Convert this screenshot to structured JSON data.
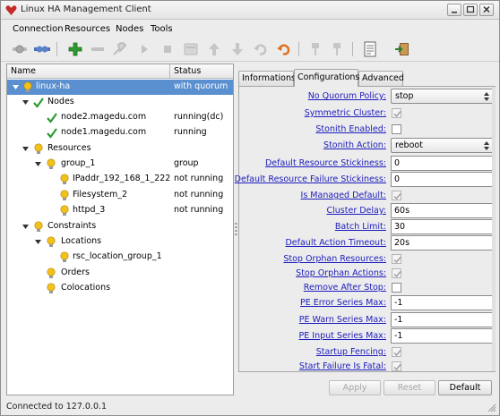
{
  "window": {
    "title": "Linux HA Management Client",
    "icon": "linux-ha-heart-icon"
  },
  "menubar": {
    "items": [
      "Connection",
      "Resources",
      "Nodes",
      "Tools"
    ]
  },
  "toolbar": {
    "icons": [
      "connect-icon",
      "disconnect-icon",
      "add-icon",
      "remove-icon",
      "cleanup-icon",
      "start-icon",
      "stop-icon",
      "default-view-icon",
      "move-up-icon",
      "move-down-icon",
      "undo-icon",
      "refresh-icon",
      "standby-node-icon",
      "active-node-icon",
      "log-icon",
      "exit-icon"
    ]
  },
  "tree": {
    "columns": {
      "name": "Name",
      "status": "Status"
    },
    "rows": [
      {
        "label": "linux-ha",
        "status": "with quorum",
        "icon": "bulb-icon",
        "expanded": true,
        "selected": true
      },
      {
        "label": "Nodes",
        "status": "",
        "icon": "check-icon",
        "expanded": true
      },
      {
        "label": "node2.magedu.com",
        "status": "running(dc)",
        "icon": "check-icon"
      },
      {
        "label": "node1.magedu.com",
        "status": "running",
        "icon": "check-icon"
      },
      {
        "label": "Resources",
        "status": "",
        "icon": "bulb-icon",
        "expanded": true
      },
      {
        "label": "group_1",
        "status": "group",
        "icon": "bulb-icon",
        "expanded": true
      },
      {
        "label": "IPaddr_192_168_1_222",
        "status": "not running",
        "icon": "bulb-icon"
      },
      {
        "label": "Filesystem_2",
        "status": "not running",
        "icon": "bulb-icon"
      },
      {
        "label": "httpd_3",
        "status": "not running",
        "icon": "bulb-icon"
      },
      {
        "label": "Constraints",
        "status": "",
        "icon": "bulb-icon",
        "expanded": true
      },
      {
        "label": "Locations",
        "status": "",
        "icon": "bulb-icon",
        "expanded": true
      },
      {
        "label": "rsc_location_group_1",
        "status": "",
        "icon": "bulb-icon"
      },
      {
        "label": "Orders",
        "status": "",
        "icon": "bulb-icon"
      },
      {
        "label": "Colocations",
        "status": "",
        "icon": "bulb-icon"
      }
    ]
  },
  "tabs": {
    "items": [
      "Informations",
      "Configurations",
      "Advanced"
    ],
    "active": "Configurations"
  },
  "config": {
    "fields": [
      {
        "label": "No Quorum Policy:",
        "type": "select",
        "value": "stop"
      },
      {
        "label": "Symmetric Cluster:",
        "type": "checkbox",
        "checked": true
      },
      {
        "label": "Stonith Enabled:",
        "type": "checkbox",
        "checked": false
      },
      {
        "label": "Stonith Action:",
        "type": "select",
        "value": "reboot"
      },
      {
        "label": "Default Resource Stickiness:",
        "type": "text",
        "value": "0"
      },
      {
        "label": "Default Resource Failure Stickiness:",
        "type": "text",
        "value": "0"
      },
      {
        "label": "Is Managed Default:",
        "type": "checkbox",
        "checked": true
      },
      {
        "label": "Cluster Delay:",
        "type": "text",
        "value": "60s"
      },
      {
        "label": "Batch Limit:",
        "type": "text",
        "value": "30"
      },
      {
        "label": "Default Action Timeout:",
        "type": "text",
        "value": "20s"
      },
      {
        "label": "Stop Orphan Resources:",
        "type": "checkbox",
        "checked": true
      },
      {
        "label": "Stop Orphan Actions:",
        "type": "checkbox",
        "checked": true
      },
      {
        "label": "Remove After Stop:",
        "type": "checkbox",
        "checked": false
      },
      {
        "label": "PE Error Series Max:",
        "type": "text",
        "value": "-1"
      },
      {
        "label": "PE Warn Series Max:",
        "type": "text",
        "value": "-1"
      },
      {
        "label": "PE Input Series Max:",
        "type": "text",
        "value": "-1"
      },
      {
        "label": "Startup Fencing:",
        "type": "checkbox",
        "checked": true
      },
      {
        "label": "Start Failure Is Fatal:",
        "type": "checkbox",
        "checked": true
      }
    ]
  },
  "buttons": {
    "apply": "Apply",
    "reset": "Reset",
    "default": "Default"
  },
  "statusbar": {
    "text": "Connected to 127.0.0.1"
  },
  "colors": {
    "selection": "#5a8fd0",
    "link_label": "#1c1cbd",
    "bulb": "#f2c21b",
    "check": "#2f9a2f"
  }
}
